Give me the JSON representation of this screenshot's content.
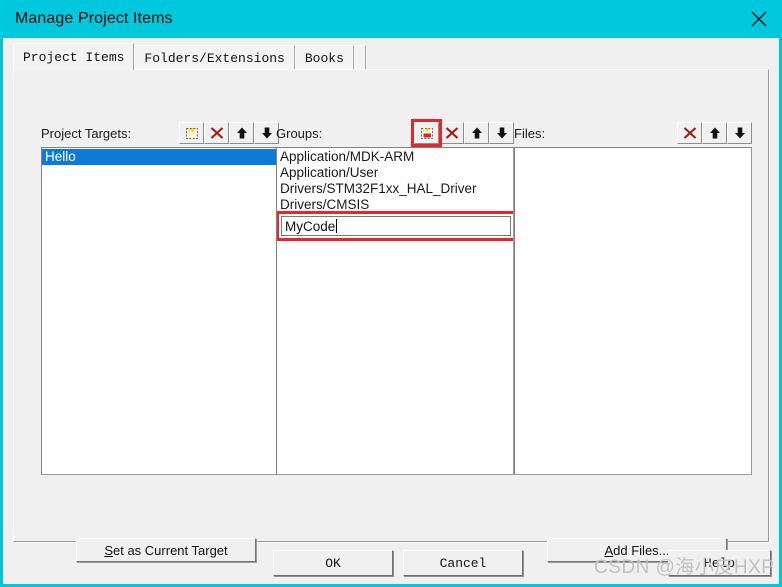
{
  "window": {
    "title": "Manage Project Items",
    "close_icon": "close-icon",
    "accent_color": "#00c8dc"
  },
  "tabs": [
    {
      "label": "Project Items",
      "active": true
    },
    {
      "label": "Folders/Extensions",
      "active": false
    },
    {
      "label": "Books",
      "active": false
    }
  ],
  "columns": {
    "targets": {
      "label": "Project Targets:",
      "tools": [
        {
          "name": "new-target-icon",
          "glyph": "new-item"
        },
        {
          "name": "delete-target-icon",
          "glyph": "x"
        },
        {
          "name": "move-target-up-icon",
          "glyph": "up"
        },
        {
          "name": "move-target-down-icon",
          "glyph": "down"
        }
      ],
      "items": [
        {
          "text": "Hello",
          "selected": true
        }
      ]
    },
    "groups": {
      "label": "Groups:",
      "tools": [
        {
          "name": "new-group-icon",
          "glyph": "new-item",
          "highlighted": true
        },
        {
          "name": "delete-group-icon",
          "glyph": "x"
        },
        {
          "name": "move-group-up-icon",
          "glyph": "up"
        },
        {
          "name": "move-group-down-icon",
          "glyph": "down"
        }
      ],
      "items": [
        {
          "text": "Application/MDK-ARM",
          "selected": false
        },
        {
          "text": "Application/User",
          "selected": false
        },
        {
          "text": "Drivers/STM32F1xx_HAL_Driver",
          "selected": false
        },
        {
          "text": "Drivers/CMSIS",
          "selected": false
        }
      ],
      "editing": {
        "value": "MyCode",
        "placeholder": "",
        "highlight_color": "#e8262a"
      }
    },
    "files": {
      "label": "Files:",
      "tools": [
        {
          "name": "delete-file-icon",
          "glyph": "x"
        },
        {
          "name": "move-file-up-icon",
          "glyph": "up"
        },
        {
          "name": "move-file-down-icon",
          "glyph": "down"
        }
      ],
      "items": []
    }
  },
  "actions": {
    "set_as_current_target": {
      "prefix": "S",
      "rest": "et as Current Target"
    },
    "add_files": {
      "prefix": "A",
      "rest": "dd Files..."
    }
  },
  "footer": {
    "ok": "OK",
    "cancel": "Cancel",
    "help": "Help"
  },
  "watermark": "CSDN @海小皮HXP"
}
